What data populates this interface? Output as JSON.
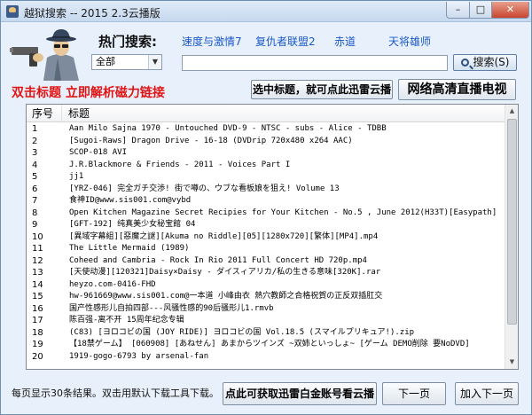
{
  "window": {
    "title": "越狱搜索 -- 2015 2.3云播版",
    "min_glyph": "–",
    "max_glyph": "□",
    "close_glyph": "✕"
  },
  "hot": {
    "label": "热门搜索:",
    "links": [
      "速度与激情7",
      "复仇者联盟2",
      "赤道",
      "天将雄师"
    ]
  },
  "search": {
    "category": "全部",
    "value": "",
    "button_label": "搜索(S)"
  },
  "hint_red": "双击标题 立即解析磁力链接",
  "btn_thunder_label": "选中标题，就可点此迅雷云播",
  "btn_tv_label": "网络高清直播电视",
  "list": {
    "col_no": "序号",
    "col_title": "标题",
    "rows": [
      {
        "no": "1",
        "title": "Aan Milo Sajna 1970  - Untouched DVD-9 - NTSC - subs - Alice - TDBB"
      },
      {
        "no": "2",
        "title": "[Sugoi-Raws] Dragon Drive - 16-18 (DVDrip 720x480 x264 AAC)"
      },
      {
        "no": "3",
        "title": "SCOP-018 AVI"
      },
      {
        "no": "4",
        "title": "J.R.Blackmore & Friends - 2011  - Voices Part I"
      },
      {
        "no": "5",
        "title": "jj1"
      },
      {
        "no": "6",
        "title": "[YRZ-046] 完全ガチ交渉! 街で噂の、ウブな看板娘を狙え! Volume 13"
      },
      {
        "no": "7",
        "title": "食神ID@www.sis001.com@vybd"
      },
      {
        "no": "8",
        "title": "Open Kitchen Magazine Secret Recipies for Your Kitchen - No.5 , June 2012(H33T)[Easypath]"
      },
      {
        "no": "9",
        "title": "[GFT-192] 纯真美少女秘宝館 04"
      },
      {
        "no": "10",
        "title": "[異域字幕組][惡魔之謎][Akuma no Riddle][05][1280x720][繁体][MP4].mp4"
      },
      {
        "no": "11",
        "title": "The Little Mermaid (1989)"
      },
      {
        "no": "12",
        "title": "Coheed and Cambria - Rock In Rio 2011 Full Concert HD 720p.mp4"
      },
      {
        "no": "13",
        "title": "[天使动漫][120321]Daisy×Daisy - ダイスィアリカ/私の生きる意味[320K].rar"
      },
      {
        "no": "14",
        "title": "heyzo.com-0416-FHD"
      },
      {
        "no": "15",
        "title": "hw-961669@www.sis001.com@一本道 小峰由衣 熱穴教師之合格祝賀の正反双插肛交"
      },
      {
        "no": "16",
        "title": "国产性感形儿自拍四部---风骚性感的90后骚形儿1.rmvb"
      },
      {
        "no": "17",
        "title": "陈百强-离不开 15周年纪念专辑"
      },
      {
        "no": "18",
        "title": "(C83) [ヨロコビの国 (JOY RIDE)] ヨロコビの国 Vol.18.5 (スマイルプリキュア!).zip"
      },
      {
        "no": "19",
        "title": "【18禁ゲーム】 [060908] [あねせん] あまからツインズ ~双姉といっしょ~ [ゲーム DEMO削除 要NoDVD]"
      },
      {
        "no": "20",
        "title": "1919-gogo-6793 by arsenal-fan"
      }
    ]
  },
  "status_text": "每页显示30条结果。双击用默认下载工具下载。",
  "btn_gold_label": "点此可获取迅雷白金账号看云播",
  "btn_next_label": "下一页",
  "btn_addnext_label": "加入下一页",
  "icons": {
    "app": "app-icon",
    "mascot": "spy-with-gun-icon",
    "search": "magnifier-icon"
  },
  "colors": {
    "link": "#1a57c8",
    "red_hint": "#e01414",
    "window_bg": "#e8f1fb"
  }
}
